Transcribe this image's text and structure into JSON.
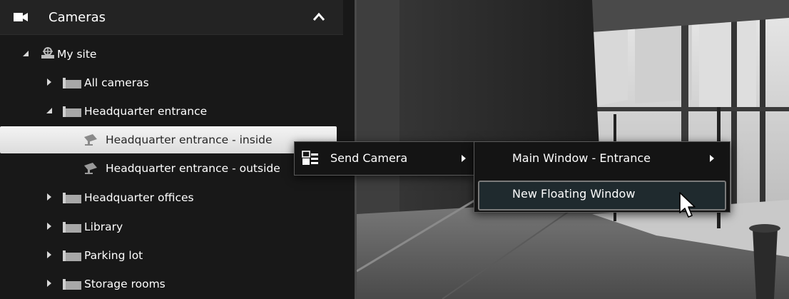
{
  "panel": {
    "title": "Cameras",
    "tree": [
      {
        "label": "My site"
      },
      {
        "label": "All cameras"
      },
      {
        "label": "Headquarter entrance"
      },
      {
        "label": "Headquarter entrance - inside"
      },
      {
        "label": "Headquarter entrance - outside"
      },
      {
        "label": "Headquarter offices"
      },
      {
        "label": "Library"
      },
      {
        "label": "Parking lot"
      },
      {
        "label": "Storage rooms"
      }
    ]
  },
  "context_menu": {
    "send_camera": "Send Camera",
    "submenu": {
      "main_window": "Main Window - Entrance",
      "new_floating": "New Floating Window"
    }
  },
  "colors": {
    "panel_bg": "#181818",
    "selection": "#e8e8e8",
    "menu_bg": "#141414",
    "text": "#ffffff"
  },
  "icons": [
    "camera-icon",
    "chevron-up-icon",
    "expand-triangle-icon",
    "site-icon",
    "folder-icon",
    "send-camera-icon",
    "submenu-arrow-icon",
    "mouse-cursor-icon"
  ]
}
